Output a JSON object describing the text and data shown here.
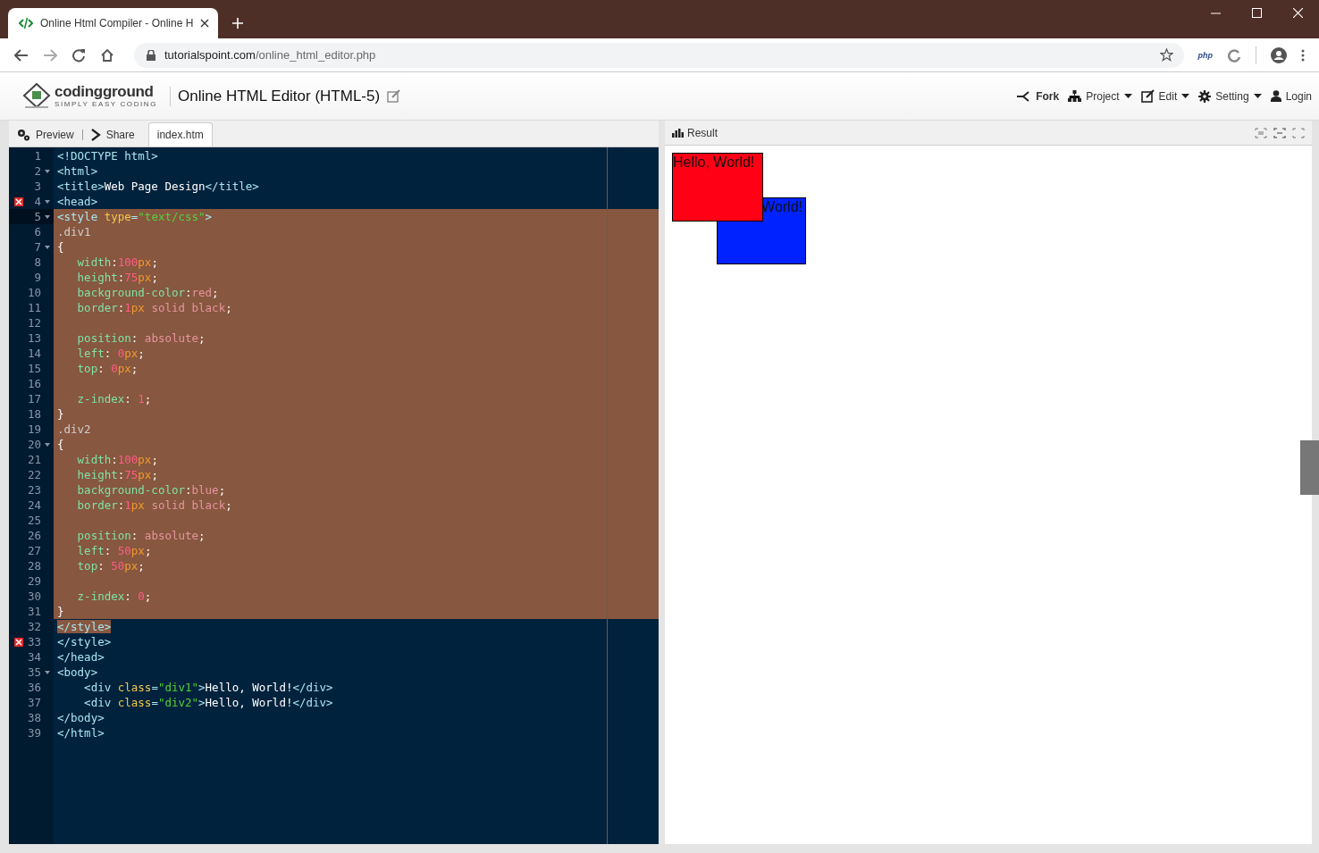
{
  "browser": {
    "tab_title": "Online Html Compiler - Online H",
    "url_domain": "tutorialspoint.com",
    "url_path": "/online_html_editor.php",
    "extension_label": "php"
  },
  "header": {
    "logo_name": "codingground",
    "logo_tagline": "SIMPLY EASY CODING",
    "title": "Online HTML Editor (HTML-5)",
    "nav": [
      {
        "label": "Fork",
        "kind": "fork",
        "emphasized": true,
        "dropdown": false
      },
      {
        "label": "Project",
        "kind": "project",
        "emphasized": false,
        "dropdown": true
      },
      {
        "label": "Edit",
        "kind": "edit",
        "emphasized": false,
        "dropdown": true
      },
      {
        "label": "Setting",
        "kind": "setting",
        "emphasized": false,
        "dropdown": true
      },
      {
        "label": "Login",
        "kind": "login",
        "emphasized": false,
        "dropdown": false
      }
    ]
  },
  "editor_tabs": [
    {
      "label": "Preview",
      "kind": "preview",
      "selected": false
    },
    {
      "label": "Share",
      "kind": "share",
      "selected": false
    },
    {
      "label": "index.htm",
      "kind": "file",
      "selected": true
    }
  ],
  "result_label": "Result",
  "code": [
    {
      "n": "1",
      "fold": false,
      "error": false,
      "active": false,
      "selected": false,
      "tokens": [
        {
          "kind": "tag",
          "text": "<!DOCTYPE html>"
        }
      ]
    },
    {
      "n": "2",
      "fold": true,
      "error": false,
      "active": false,
      "selected": false,
      "tokens": [
        {
          "kind": "tag",
          "text": "<html>"
        }
      ]
    },
    {
      "n": "3",
      "fold": false,
      "error": false,
      "active": false,
      "selected": false,
      "tokens": [
        {
          "kind": "tag",
          "text": "<title>"
        },
        {
          "kind": "text",
          "text": "Web Page Design"
        },
        {
          "kind": "tag",
          "text": "</title>"
        }
      ]
    },
    {
      "n": "4",
      "fold": true,
      "error": true,
      "active": false,
      "selected": false,
      "tokens": [
        {
          "kind": "tag",
          "text": "<head>"
        }
      ]
    },
    {
      "n": "5",
      "fold": true,
      "error": false,
      "active": true,
      "selected": true,
      "tokens": [
        {
          "kind": "tag",
          "text": "<style "
        },
        {
          "kind": "attr",
          "text": "type"
        },
        {
          "kind": "tag",
          "text": "="
        },
        {
          "kind": "str",
          "text": "\"text/css\""
        },
        {
          "kind": "tag",
          "text": ">"
        }
      ]
    },
    {
      "n": "6",
      "fold": false,
      "error": false,
      "active": false,
      "selected": true,
      "tokens": [
        {
          "kind": "sel",
          "text": ".div1"
        }
      ]
    },
    {
      "n": "7",
      "fold": true,
      "error": false,
      "active": false,
      "selected": true,
      "tokens": [
        {
          "kind": "text",
          "text": "{"
        }
      ]
    },
    {
      "n": "8",
      "fold": false,
      "error": false,
      "active": false,
      "selected": true,
      "tokens": [
        {
          "kind": "prop",
          "text": "   width"
        },
        {
          "kind": "text",
          "text": ":"
        },
        {
          "kind": "num",
          "text": "100"
        },
        {
          "kind": "unit",
          "text": "px"
        },
        {
          "kind": "text",
          "text": ";"
        }
      ]
    },
    {
      "n": "9",
      "fold": false,
      "error": false,
      "active": false,
      "selected": true,
      "tokens": [
        {
          "kind": "prop",
          "text": "   height"
        },
        {
          "kind": "text",
          "text": ":"
        },
        {
          "kind": "num",
          "text": "75"
        },
        {
          "kind": "unit",
          "text": "px"
        },
        {
          "kind": "text",
          "text": ";"
        }
      ]
    },
    {
      "n": "10",
      "fold": false,
      "error": false,
      "active": false,
      "selected": true,
      "tokens": [
        {
          "kind": "prop",
          "text": "   background-color"
        },
        {
          "kind": "text",
          "text": ":"
        },
        {
          "kind": "val",
          "text": "red"
        },
        {
          "kind": "text",
          "text": ";"
        }
      ]
    },
    {
      "n": "11",
      "fold": false,
      "error": false,
      "active": false,
      "selected": true,
      "tokens": [
        {
          "kind": "prop",
          "text": "   border"
        },
        {
          "kind": "text",
          "text": ":"
        },
        {
          "kind": "num",
          "text": "1"
        },
        {
          "kind": "unit",
          "text": "px"
        },
        {
          "kind": "val",
          "text": " solid black"
        },
        {
          "kind": "text",
          "text": ";"
        }
      ]
    },
    {
      "n": "12",
      "fold": false,
      "error": false,
      "active": false,
      "selected": true
    },
    {
      "n": "13",
      "fold": false,
      "error": false,
      "active": false,
      "selected": true,
      "tokens": [
        {
          "kind": "prop",
          "text": "   position"
        },
        {
          "kind": "text",
          "text": ": "
        },
        {
          "kind": "val",
          "text": "absolute"
        },
        {
          "kind": "text",
          "text": ";"
        }
      ]
    },
    {
      "n": "14",
      "fold": false,
      "error": false,
      "active": false,
      "selected": true,
      "tokens": [
        {
          "kind": "prop",
          "text": "   left"
        },
        {
          "kind": "text",
          "text": ": "
        },
        {
          "kind": "num",
          "text": "0"
        },
        {
          "kind": "unit",
          "text": "px"
        },
        {
          "kind": "text",
          "text": ";"
        }
      ]
    },
    {
      "n": "15",
      "fold": false,
      "error": false,
      "active": false,
      "selected": true,
      "tokens": [
        {
          "kind": "prop",
          "text": "   top"
        },
        {
          "kind": "text",
          "text": ": "
        },
        {
          "kind": "num",
          "text": "0"
        },
        {
          "kind": "unit",
          "text": "px"
        },
        {
          "kind": "text",
          "text": ";"
        }
      ]
    },
    {
      "n": "16",
      "fold": false,
      "error": false,
      "active": false,
      "selected": true
    },
    {
      "n": "17",
      "fold": false,
      "error": false,
      "active": false,
      "selected": true,
      "tokens": [
        {
          "kind": "prop",
          "text": "   z-index"
        },
        {
          "kind": "text",
          "text": ": "
        },
        {
          "kind": "num",
          "text": "1"
        },
        {
          "kind": "text",
          "text": ";"
        }
      ]
    },
    {
      "n": "18",
      "fold": false,
      "error": false,
      "active": false,
      "selected": true,
      "tokens": [
        {
          "kind": "text",
          "text": "}"
        }
      ]
    },
    {
      "n": "19",
      "fold": false,
      "error": false,
      "active": false,
      "selected": true,
      "tokens": [
        {
          "kind": "sel",
          "text": ".div2"
        }
      ]
    },
    {
      "n": "20",
      "fold": true,
      "error": false,
      "active": false,
      "selected": true,
      "tokens": [
        {
          "kind": "text",
          "text": "{"
        }
      ]
    },
    {
      "n": "21",
      "fold": false,
      "error": false,
      "active": false,
      "selected": true,
      "tokens": [
        {
          "kind": "prop",
          "text": "   width"
        },
        {
          "kind": "text",
          "text": ":"
        },
        {
          "kind": "num",
          "text": "100"
        },
        {
          "kind": "unit",
          "text": "px"
        },
        {
          "kind": "text",
          "text": ";"
        }
      ]
    },
    {
      "n": "22",
      "fold": false,
      "error": false,
      "active": false,
      "selected": true,
      "tokens": [
        {
          "kind": "prop",
          "text": "   height"
        },
        {
          "kind": "text",
          "text": ":"
        },
        {
          "kind": "num",
          "text": "75"
        },
        {
          "kind": "unit",
          "text": "px"
        },
        {
          "kind": "text",
          "text": ";"
        }
      ]
    },
    {
      "n": "23",
      "fold": false,
      "error": false,
      "active": false,
      "selected": true,
      "tokens": [
        {
          "kind": "prop",
          "text": "   background-color"
        },
        {
          "kind": "text",
          "text": ":"
        },
        {
          "kind": "val",
          "text": "blue"
        },
        {
          "kind": "text",
          "text": ";"
        }
      ]
    },
    {
      "n": "24",
      "fold": false,
      "error": false,
      "active": false,
      "selected": true,
      "tokens": [
        {
          "kind": "prop",
          "text": "   border"
        },
        {
          "kind": "text",
          "text": ":"
        },
        {
          "kind": "num",
          "text": "1"
        },
        {
          "kind": "unit",
          "text": "px"
        },
        {
          "kind": "val",
          "text": " solid black"
        },
        {
          "kind": "text",
          "text": ";"
        }
      ]
    },
    {
      "n": "25",
      "fold": false,
      "error": false,
      "active": false,
      "selected": true
    },
    {
      "n": "26",
      "fold": false,
      "error": false,
      "active": false,
      "selected": true,
      "tokens": [
        {
          "kind": "prop",
          "text": "   position"
        },
        {
          "kind": "text",
          "text": ": "
        },
        {
          "kind": "val",
          "text": "absolute"
        },
        {
          "kind": "text",
          "text": ";"
        }
      ]
    },
    {
      "n": "27",
      "fold": false,
      "error": false,
      "active": false,
      "selected": true,
      "tokens": [
        {
          "kind": "prop",
          "text": "   left"
        },
        {
          "kind": "text",
          "text": ": "
        },
        {
          "kind": "num",
          "text": "50"
        },
        {
          "kind": "unit",
          "text": "px"
        },
        {
          "kind": "text",
          "text": ";"
        }
      ]
    },
    {
      "n": "28",
      "fold": false,
      "error": false,
      "active": false,
      "selected": true,
      "tokens": [
        {
          "kind": "prop",
          "text": "   top"
        },
        {
          "kind": "text",
          "text": ": "
        },
        {
          "kind": "num",
          "text": "50"
        },
        {
          "kind": "unit",
          "text": "px"
        },
        {
          "kind": "text",
          "text": ";"
        }
      ]
    },
    {
      "n": "29",
      "fold": false,
      "error": false,
      "active": false,
      "selected": true
    },
    {
      "n": "30",
      "fold": false,
      "error": false,
      "active": false,
      "selected": true,
      "tokens": [
        {
          "kind": "prop",
          "text": "   z-index"
        },
        {
          "kind": "text",
          "text": ": "
        },
        {
          "kind": "num",
          "text": "0"
        },
        {
          "kind": "text",
          "text": ";"
        }
      ]
    },
    {
      "n": "31",
      "fold": false,
      "error": false,
      "active": false,
      "selected": true,
      "tokens": [
        {
          "kind": "text",
          "text": "}"
        }
      ]
    },
    {
      "n": "32",
      "fold": false,
      "error": false,
      "active": false,
      "selected": true,
      "tokens": [
        {
          "kind": "tag",
          "text": "</style>"
        }
      ]
    },
    {
      "n": "33",
      "fold": false,
      "error": true,
      "active": false,
      "selected": false,
      "tokens": [
        {
          "kind": "tag",
          "text": "</style>"
        }
      ]
    },
    {
      "n": "34",
      "fold": false,
      "error": false,
      "active": false,
      "selected": false,
      "tokens": [
        {
          "kind": "tag",
          "text": "</head>"
        }
      ]
    },
    {
      "n": "35",
      "fold": true,
      "error": false,
      "active": false,
      "selected": false,
      "tokens": [
        {
          "kind": "tag",
          "text": "<body>"
        }
      ]
    },
    {
      "n": "36",
      "fold": false,
      "error": false,
      "active": false,
      "selected": false,
      "tokens": [
        {
          "kind": "tag",
          "text": "    <div "
        },
        {
          "kind": "attr",
          "text": "class"
        },
        {
          "kind": "tag",
          "text": "="
        },
        {
          "kind": "str",
          "text": "\"div1\""
        },
        {
          "kind": "tag",
          "text": ">"
        },
        {
          "kind": "text",
          "text": "Hello, World!"
        },
        {
          "kind": "tag",
          "text": "</div>"
        }
      ]
    },
    {
      "n": "37",
      "fold": false,
      "error": false,
      "active": false,
      "selected": false,
      "tokens": [
        {
          "kind": "tag",
          "text": "    <div "
        },
        {
          "kind": "attr",
          "text": "class"
        },
        {
          "kind": "tag",
          "text": "="
        },
        {
          "kind": "str",
          "text": "\"div2\""
        },
        {
          "kind": "tag",
          "text": ">"
        },
        {
          "kind": "text",
          "text": "Hello, World!"
        },
        {
          "kind": "tag",
          "text": "</div>"
        }
      ]
    },
    {
      "n": "38",
      "fold": false,
      "error": false,
      "active": false,
      "selected": false,
      "tokens": [
        {
          "kind": "tag",
          "text": "</body>"
        }
      ]
    },
    {
      "n": "39",
      "fold": false,
      "error": false,
      "active": false,
      "selected": false,
      "tokens": [
        {
          "kind": "tag",
          "text": "</html>"
        }
      ]
    }
  ],
  "result_boxes": [
    {
      "text": "Hello, World!",
      "color": "#ff0015"
    },
    {
      "text": "World!",
      "color": "#0022ff"
    }
  ]
}
